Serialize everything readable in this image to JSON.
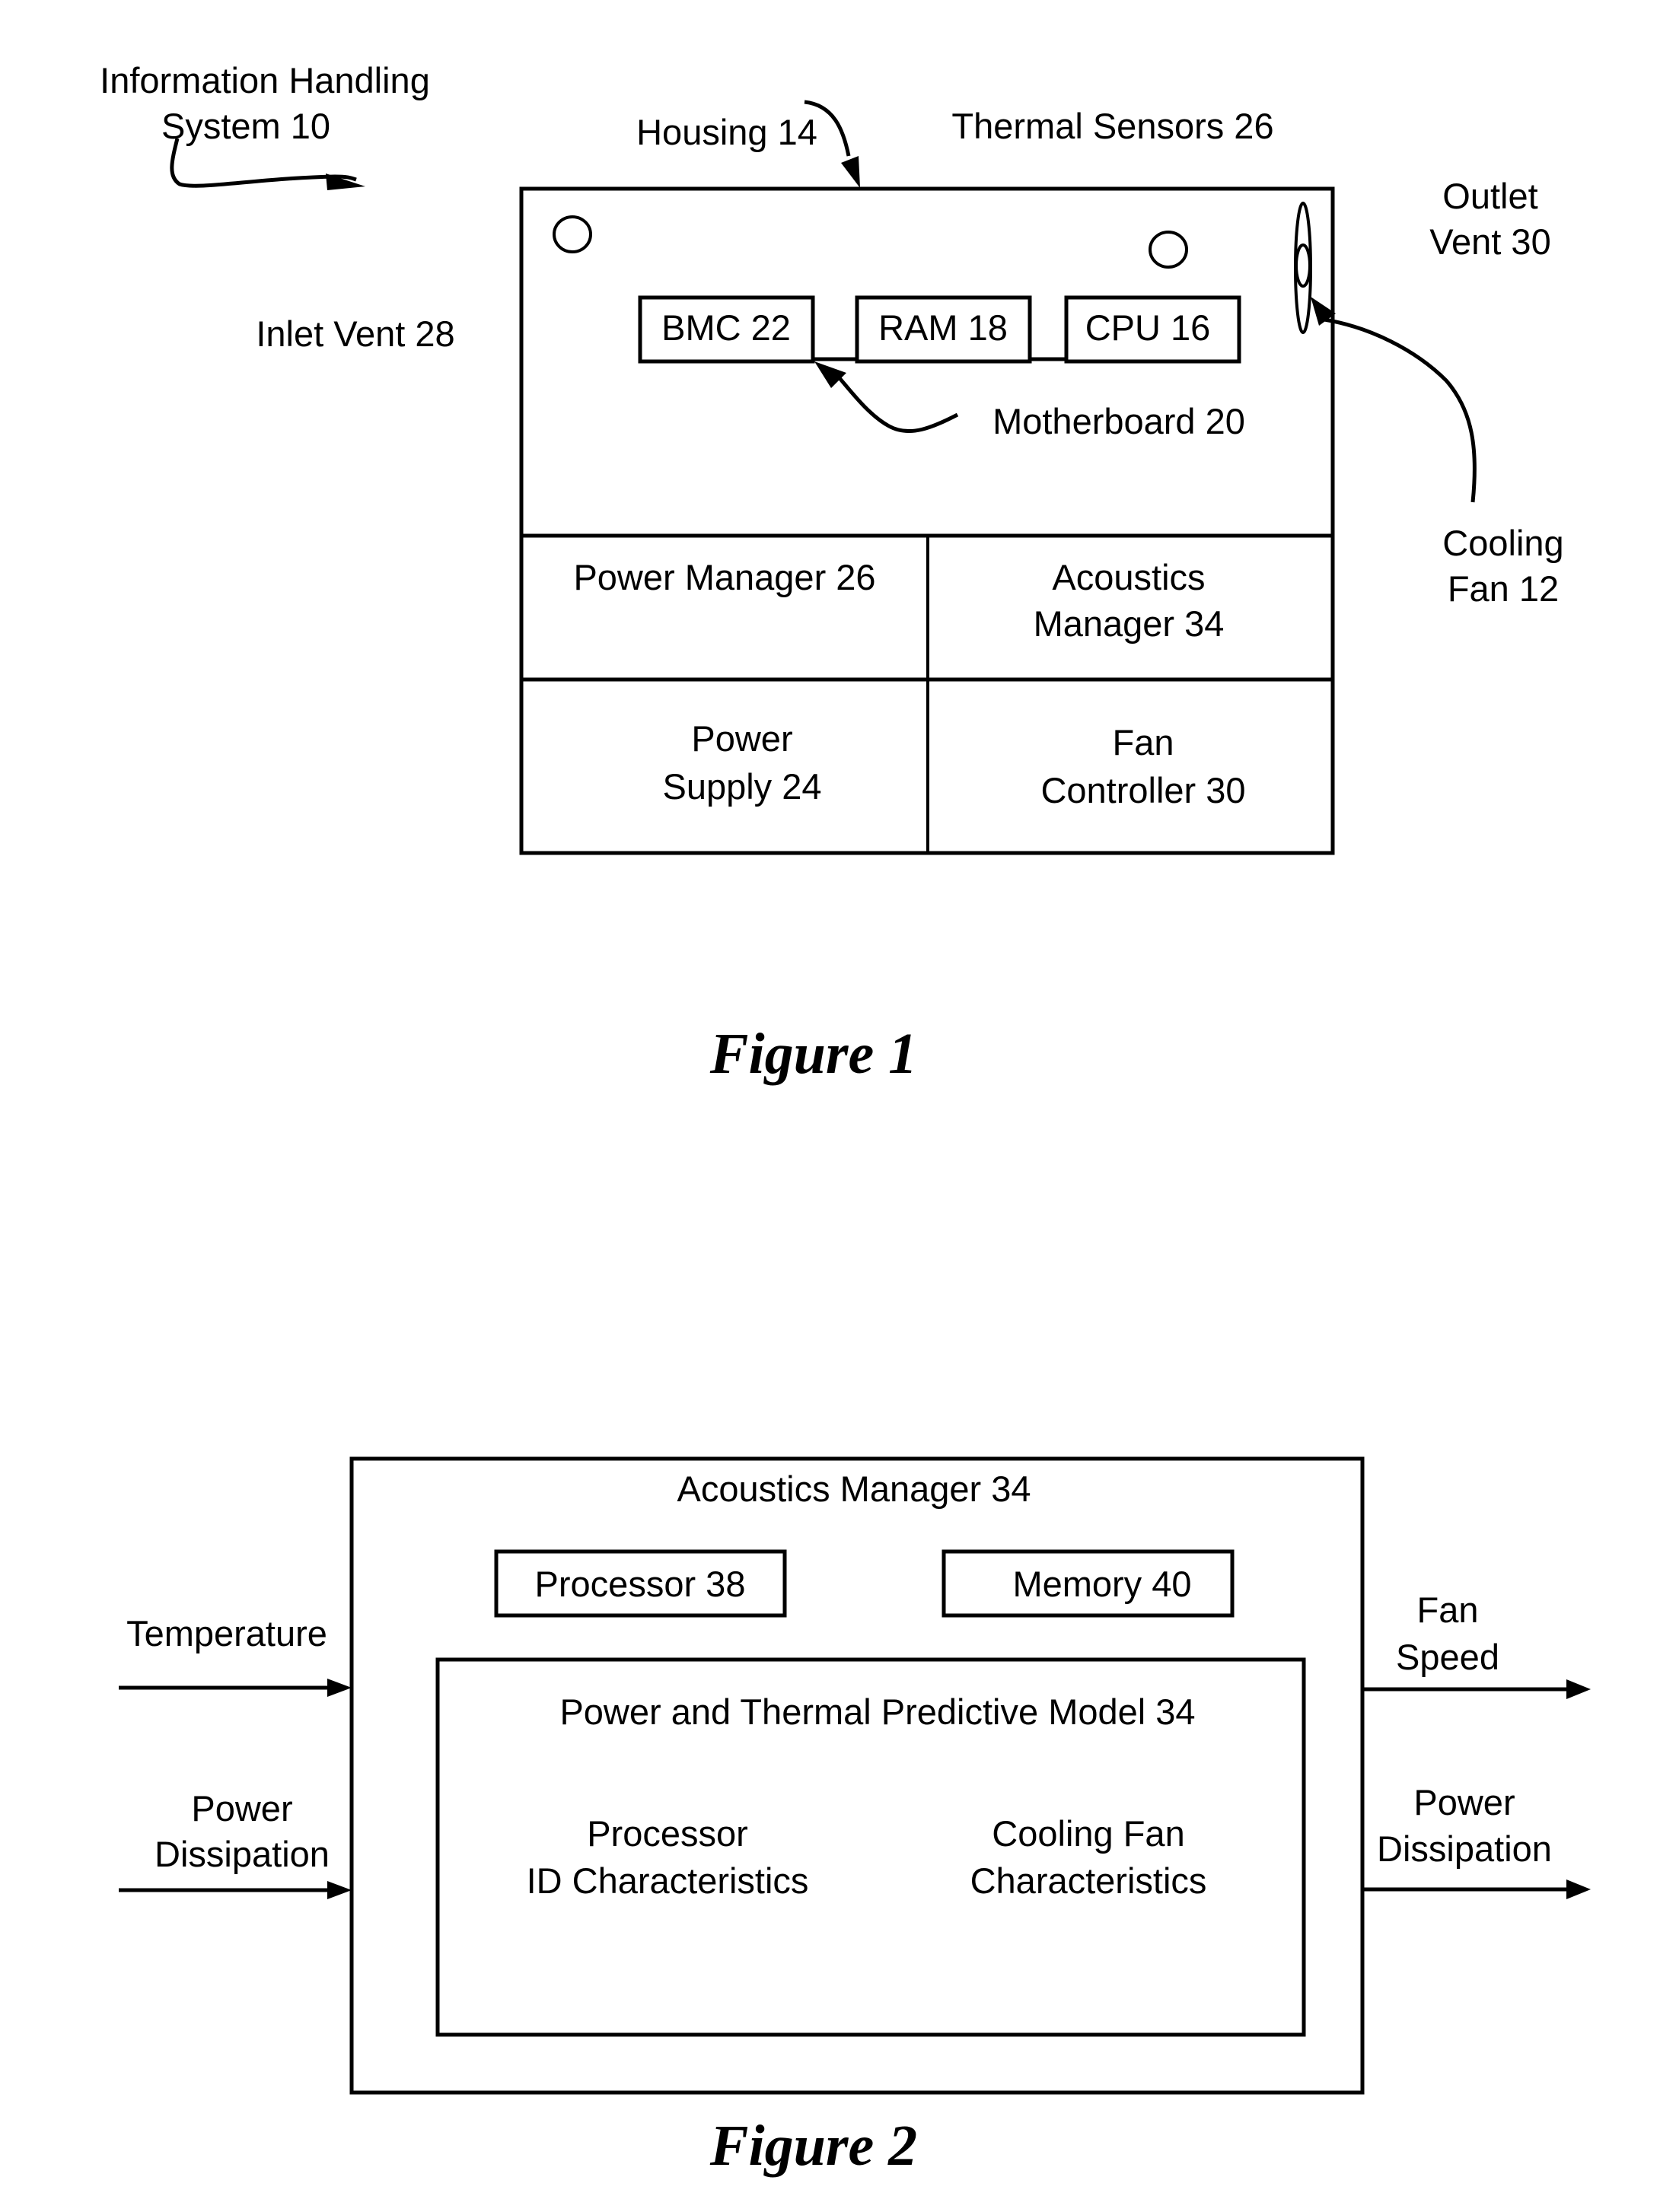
{
  "figure1": {
    "caption": "Figure 1",
    "labels": {
      "ihs_line1": "Information Handling",
      "ihs_line2": "System 10",
      "housing": "Housing 14",
      "thermal_sensors": "Thermal Sensors 26",
      "outlet_vent_line1": "Outlet",
      "outlet_vent_line2": "Vent 30",
      "inlet_vent": "Inlet Vent 28",
      "motherboard": "Motherboard 20",
      "cooling_fan_line1": "Cooling",
      "cooling_fan_line2": "Fan 12"
    },
    "components": {
      "bmc": "BMC 22",
      "ram": "RAM 18",
      "cpu": "CPU 16"
    },
    "grid": {
      "power_manager": "Power Manager 26",
      "acoustics_manager_line1": "Acoustics",
      "acoustics_manager_line2": "Manager 34",
      "power_supply_line1": "Power",
      "power_supply_line2": "Supply 24",
      "fan_controller_line1": "Fan",
      "fan_controller_line2": "Controller 30"
    }
  },
  "figure2": {
    "caption": "Figure 2",
    "outer_title": "Acoustics Manager 34",
    "processor": "Processor 38",
    "memory": "Memory 40",
    "model": {
      "title": "Power and Thermal Predictive Model 34",
      "left_line1": "Processor",
      "left_line2": "ID Characteristics",
      "right_line1": "Cooling Fan",
      "right_line2": "Characteristics"
    },
    "inputs": {
      "temperature": "Temperature",
      "power_line1": "Power",
      "power_line2": "Dissipation"
    },
    "outputs": {
      "fan_speed_line1": "Fan",
      "fan_speed_line2": "Speed",
      "power_line1": "Power",
      "power_line2": "Dissipation"
    }
  }
}
